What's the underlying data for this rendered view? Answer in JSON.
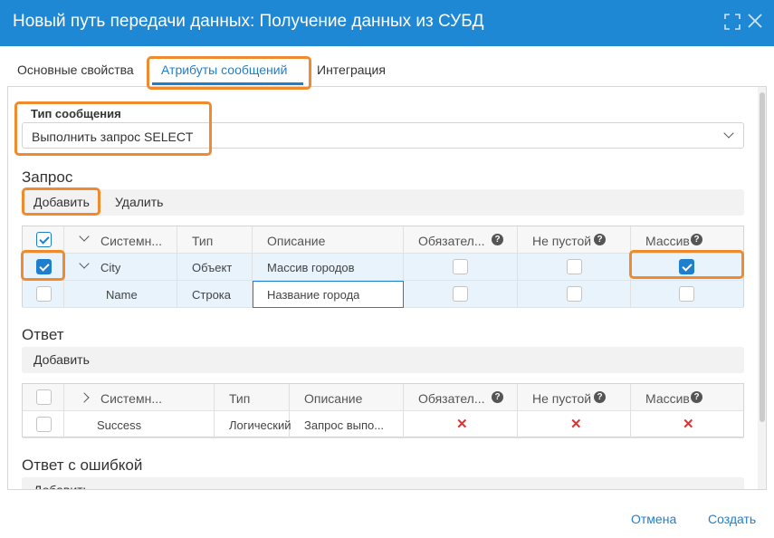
{
  "dialog": {
    "title": "Новый путь передачи данных: Получение данных из СУБД"
  },
  "icons": {
    "expand": "expand-icon",
    "close": "close-icon"
  },
  "tabs": [
    {
      "label": "Основные свойства",
      "active": false
    },
    {
      "label": "Атрибуты сообщений",
      "active": true
    },
    {
      "label": "Интеграция",
      "active": false
    }
  ],
  "message_type": {
    "label": "Тип сообщения",
    "value": "Выполнить запрос SELECT"
  },
  "request": {
    "title": "Запрос",
    "add_label": "Добавить",
    "delete_label": "Удалить",
    "headers": [
      "Системн...",
      "Тип",
      "Описание",
      "Обязател...",
      "Не пустой",
      "Массив"
    ],
    "rows": [
      {
        "name": "City",
        "type": "Объект",
        "description": "Массив городов",
        "selected": true,
        "required": false,
        "not_empty": false,
        "array": true
      },
      {
        "name": "Name",
        "type": "Строка",
        "description": "Название города",
        "selected": false,
        "required": false,
        "not_empty": false,
        "array": false
      }
    ]
  },
  "response": {
    "title": "Ответ",
    "add_label": "Добавить",
    "headers": [
      "Системн...",
      "Тип",
      "Описание",
      "Обязател...",
      "Не пустой",
      "Массив"
    ],
    "rows": [
      {
        "name": "Success",
        "type": "Логический",
        "description": "Запрос выпо...",
        "required": false,
        "not_empty": false,
        "array": false
      }
    ]
  },
  "error_response": {
    "title": "Ответ с ошибкой",
    "add_label": "Добавить"
  },
  "footer": {
    "cancel_label": "Отмена",
    "create_label": "Создать"
  },
  "colors": {
    "title_bar": "#1e88d4",
    "accent": "#1e7fcf",
    "highlight": "#f08a2e",
    "error": "#d23a3a"
  }
}
